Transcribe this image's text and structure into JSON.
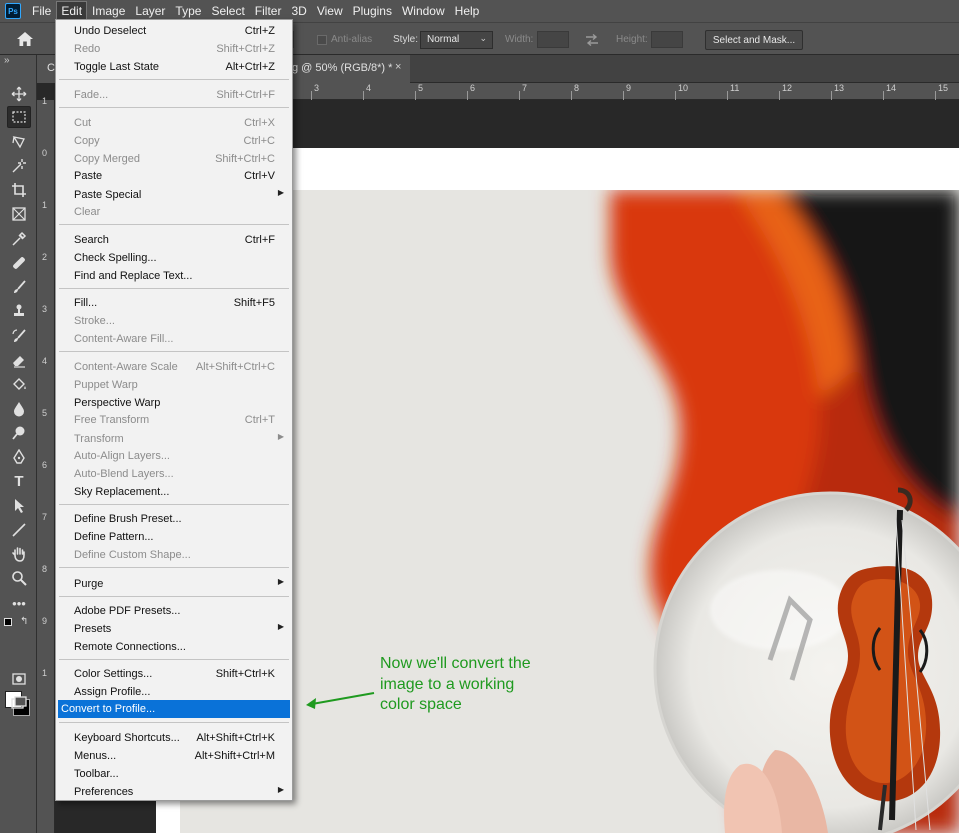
{
  "app": {
    "logo_text": "Ps"
  },
  "menubar": [
    "File",
    "Edit",
    "Image",
    "Layer",
    "Type",
    "Select",
    "Filter",
    "3D",
    "View",
    "Plugins",
    "Window",
    "Help"
  ],
  "options": {
    "anti_alias": "Anti-alias",
    "style_label": "Style:",
    "style_value": "Normal",
    "width_label": "Width:",
    "height_label": "Height:",
    "select_mask": "Select and Mask..."
  },
  "document": {
    "tab_left": "C",
    "tab_title": "g @ 50% (RGB/8*) *",
    "tab_close": "×"
  },
  "ruler": {
    "top": [
      "3",
      "4",
      "5",
      "6",
      "7",
      "8",
      "9",
      "10",
      "11",
      "12",
      "13",
      "14",
      "15"
    ],
    "left": [
      "1",
      "0",
      "1",
      "2",
      "3",
      "4",
      "5",
      "6",
      "7",
      "8",
      "9",
      "1"
    ]
  },
  "edit_menu": {
    "items": [
      {
        "label": "Undo Deselect",
        "shortcut": "Ctrl+Z",
        "disabled": false
      },
      {
        "label": "Redo",
        "shortcut": "Shift+Ctrl+Z",
        "disabled": true
      },
      {
        "label": "Toggle Last State",
        "shortcut": "Alt+Ctrl+Z",
        "disabled": false
      },
      {
        "label": "Fade...",
        "shortcut": "Shift+Ctrl+F",
        "disabled": true
      },
      {
        "label": "Cut",
        "shortcut": "Ctrl+X",
        "disabled": true
      },
      {
        "label": "Copy",
        "shortcut": "Ctrl+C",
        "disabled": true
      },
      {
        "label": "Copy Merged",
        "shortcut": "Shift+Ctrl+C",
        "disabled": true
      },
      {
        "label": "Paste",
        "shortcut": "Ctrl+V",
        "disabled": false
      },
      {
        "label": "Paste Special",
        "shortcut": "",
        "disabled": false
      },
      {
        "label": "Clear",
        "shortcut": "",
        "disabled": true
      },
      {
        "label": "Search",
        "shortcut": "Ctrl+F",
        "disabled": false
      },
      {
        "label": "Check Spelling...",
        "shortcut": "",
        "disabled": false
      },
      {
        "label": "Find and Replace Text...",
        "shortcut": "",
        "disabled": false
      },
      {
        "label": "Fill...",
        "shortcut": "Shift+F5",
        "disabled": false
      },
      {
        "label": "Stroke...",
        "shortcut": "",
        "disabled": true
      },
      {
        "label": "Content-Aware Fill...",
        "shortcut": "",
        "disabled": true
      },
      {
        "label": "Content-Aware Scale",
        "shortcut": "Alt+Shift+Ctrl+C",
        "disabled": true
      },
      {
        "label": "Puppet Warp",
        "shortcut": "",
        "disabled": true
      },
      {
        "label": "Perspective Warp",
        "shortcut": "",
        "disabled": false
      },
      {
        "label": "Free Transform",
        "shortcut": "Ctrl+T",
        "disabled": true
      },
      {
        "label": "Transform",
        "shortcut": "",
        "disabled": true
      },
      {
        "label": "Auto-Align Layers...",
        "shortcut": "",
        "disabled": true
      },
      {
        "label": "Auto-Blend Layers...",
        "shortcut": "",
        "disabled": true
      },
      {
        "label": "Sky Replacement...",
        "shortcut": "",
        "disabled": false
      },
      {
        "label": "Define Brush Preset...",
        "shortcut": "",
        "disabled": false
      },
      {
        "label": "Define Pattern...",
        "shortcut": "",
        "disabled": false
      },
      {
        "label": "Define Custom Shape...",
        "shortcut": "",
        "disabled": true
      },
      {
        "label": "Purge",
        "shortcut": "",
        "disabled": false
      },
      {
        "label": "Adobe PDF Presets...",
        "shortcut": "",
        "disabled": false
      },
      {
        "label": "Presets",
        "shortcut": "",
        "disabled": false
      },
      {
        "label": "Remote Connections...",
        "shortcut": "",
        "disabled": false
      },
      {
        "label": "Color Settings...",
        "shortcut": "Shift+Ctrl+K",
        "disabled": false
      },
      {
        "label": "Assign Profile...",
        "shortcut": "",
        "disabled": false
      },
      {
        "label": "Convert to Profile...",
        "shortcut": "",
        "disabled": false
      },
      {
        "label": "Keyboard Shortcuts...",
        "shortcut": "Alt+Shift+Ctrl+K",
        "disabled": false
      },
      {
        "label": "Menus...",
        "shortcut": "Alt+Shift+Ctrl+M",
        "disabled": false
      },
      {
        "label": "Toolbar...",
        "shortcut": "",
        "disabled": false
      },
      {
        "label": "Preferences",
        "shortcut": "",
        "disabled": false
      }
    ]
  },
  "annotation": {
    "line1": "Now we'll convert the",
    "line2": "image to a working",
    "line3": "color space",
    "color": "#1f9a1f"
  },
  "colors": {
    "highlight": "#0a72d8",
    "foreground": "#ffffff",
    "background": "#000000"
  }
}
